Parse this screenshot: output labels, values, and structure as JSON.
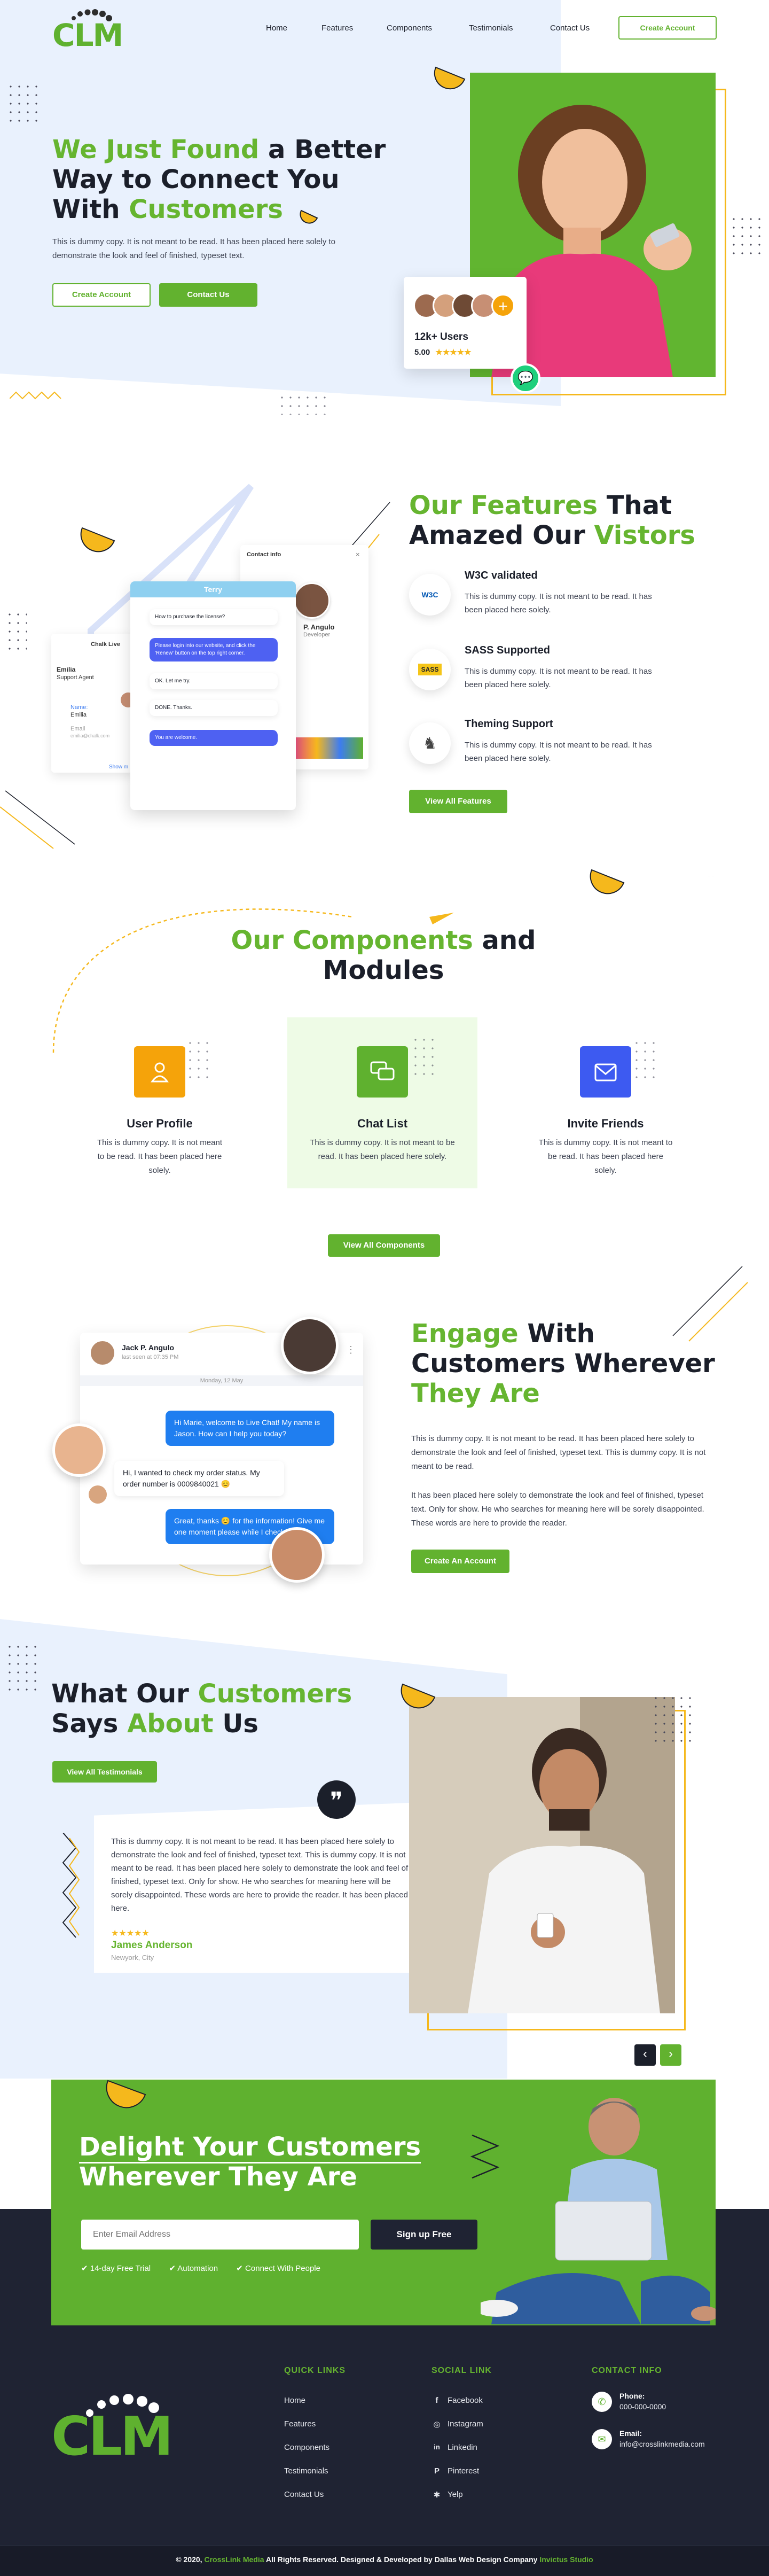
{
  "brand": {
    "logo_text": "CLM",
    "accent": "#62b22f",
    "dark": "#1d2130",
    "light_blue": "#e8f0fd",
    "yellow": "#f5b81c"
  },
  "nav": {
    "links": [
      "Home",
      "Features",
      "Components",
      "Testimonials",
      "Contact Us"
    ],
    "cta": "Create Account"
  },
  "hero": {
    "title_green_1": "We Just Found",
    "title_dark_1": " a Better",
    "title_dark_2": "Way to Connect You",
    "title_dark_3": "With ",
    "title_green_2": "Customers",
    "subtitle": "This is dummy copy. It is not meant to be read. It has been placed here solely to demonstrate the look and feel of finished, typeset text.",
    "btn_outline": "Create Account",
    "btn_solid": "Contact Us",
    "users_count": "12k+ Users",
    "rating": "5.00",
    "stars": "★★★★★",
    "plus": "+"
  },
  "features": {
    "title_green_1": "Our Features",
    "title_dark_1": " That",
    "title_dark_2": "Amazed Our ",
    "title_green_2": "Vistors",
    "items": [
      {
        "title": "W3C validated",
        "desc": "This is dummy copy. It is not meant to be read. It has been placed here solely.",
        "icon": "w3c-icon"
      },
      {
        "title": "SASS Supported",
        "desc": "This is dummy copy. It is not meant to be read. It has been placed here solely.",
        "icon": "sass-icon"
      },
      {
        "title": "Theming Support",
        "desc": "This is dummy copy. It is not meant to be read. It has been placed here solely.",
        "icon": "theme-icon"
      }
    ],
    "button": "View All Features",
    "mock": {
      "contact_info": "Contact info",
      "chat_name": "Terry",
      "left_title": "Chalk Live",
      "agent_name": "Emilia",
      "agent_role": "Support Agent",
      "name_label": "Name:",
      "name_value": "Emilia",
      "email_label": "Email",
      "email_value": "emilia@chalk.com",
      "show_more": "Show m",
      "profile_name": "P. Angulo",
      "profile_role": "Developer",
      "msgs": [
        "How to purchase the license?",
        "Please login into our website, and click the 'Renew' button on the top right corner.",
        "OK. Let me try.",
        "DONE. Thanks.",
        "You are welcome."
      ]
    }
  },
  "components": {
    "title_green": "Our Components",
    "title_dark_1": " and",
    "title_dark_2": "Modules",
    "cards": [
      {
        "title": "User Profile",
        "desc": "This is dummy copy. It is not meant to be read. It has been placed here solely.",
        "color": "#f5a30a",
        "icon": "user-icon"
      },
      {
        "title": "Chat List",
        "desc": "This is dummy copy. It is not meant to be read. It has been placed here solely.",
        "color": "#5fb12f",
        "icon": "chat-icon"
      },
      {
        "title": "Invite Friends",
        "desc": "This is dummy copy. It is not meant to be read. It has been placed here solely.",
        "color": "#3d5af1",
        "icon": "mail-icon"
      }
    ],
    "button": "View All Components"
  },
  "engage": {
    "title_green_1": "Engage",
    "title_dark_1": " With",
    "title_dark_2": "Customers Wherever",
    "title_green_2": "They Are",
    "p1": "This is dummy copy. It is not meant to be read. It has been placed here solely to demonstrate the look and feel of finished, typeset text. This is dummy copy. It is not meant to be read.",
    "p2": "It has been placed here solely to demonstrate the look and feel of finished, typeset text. Only for show. He who searches for meaning here will be sorely disappointed. These words are here to provide the reader.",
    "button": "Create An Account",
    "chat": {
      "name": "Jack P. Angulo",
      "seen": "last seen at 07:35 PM",
      "date": "Monday, 12 May",
      "m1": "Hi Marie, welcome to Live Chat! My name is Jason. How can I help you today?",
      "m2": "Hi, I wanted to check my order status. My order number is 0009840021 😊",
      "m3": "Great, thanks 😊 for the information! Give me one moment please while I check for you."
    }
  },
  "testimonials": {
    "title_dark_1": "What Our ",
    "title_green_1": "Customers",
    "title_dark_2": "Says ",
    "title_green_2": "About",
    "title_dark_3": " Us",
    "button": "View All Testimonials",
    "quote_mark": "❞",
    "quote": "This is dummy copy. It is not meant to be read. It has been placed here solely to demonstrate the look and feel of finished, typeset text. This is dummy copy. It is not meant to be read. It has been placed here solely to demonstrate the look and feel of finished, typeset text. Only for show. He who searches for meaning here will be sorely disappointed. These words are here to provide the reader. It has been placed here.",
    "stars": "★★★★★",
    "author": "James Anderson",
    "location": "Newyork, City",
    "prev": "‹",
    "next": "›"
  },
  "cta": {
    "title_1": "Delight Your Customers",
    "title_2": "Wherever They Are",
    "email_placeholder": "Enter Email Address",
    "button": "Sign up Free",
    "perks": [
      "14-day Free Trial",
      "Automation",
      "Connect With People"
    ]
  },
  "footer": {
    "quick_links_title": "QUICK LINKS",
    "quick_links": [
      "Home",
      "Features",
      "Components",
      "Testimonials",
      "Contact Us"
    ],
    "social_title": "SOCIAL LINK",
    "social": [
      {
        "label": "Facebook",
        "glyph": "f"
      },
      {
        "label": "Instagram",
        "glyph": "◎"
      },
      {
        "label": "Linkedin",
        "glyph": "in"
      },
      {
        "label": "Pinterest",
        "glyph": "P"
      },
      {
        "label": "Yelp",
        "glyph": "✱"
      }
    ],
    "contact_title": "CONTACT INFO",
    "phone_label": "Phone:",
    "phone": "000-000-0000",
    "email_label": "Email:",
    "email": "info@crosslinkmedia.com",
    "copy_1": "© 2020, ",
    "copy_brand": "CrossLink Media",
    "copy_2": " All Rights Reserved. Designed & Developed by Dallas Web Design Company ",
    "copy_studio": "Invictus Studio"
  }
}
